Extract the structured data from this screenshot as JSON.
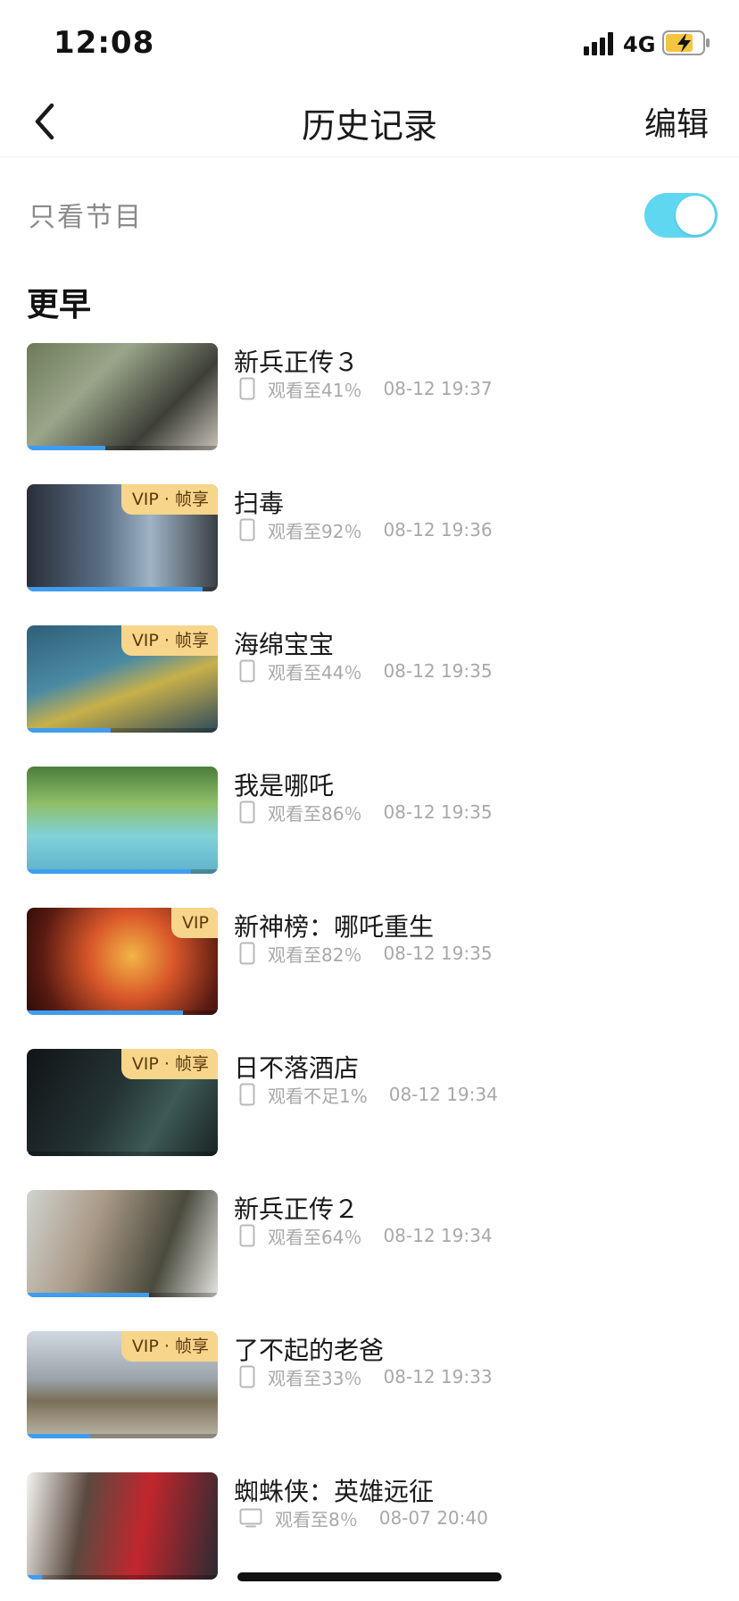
{
  "status_bar": {
    "time": "12:08",
    "network": "4G",
    "icons": [
      "signal-icon",
      "battery-charging-icon"
    ],
    "battery_color": "#f5c542"
  },
  "nav": {
    "back_icon": "chevron-left-icon",
    "title": "历史记录",
    "edit_label": "编辑"
  },
  "filter": {
    "label": "只看节目",
    "toggle_on": true,
    "toggle_color": "#5fd7f0"
  },
  "section": {
    "title": "更早"
  },
  "colors": {
    "badge_bg": "#f7d58a",
    "badge_text": "#5b3a10",
    "progress": "#3f9df0"
  },
  "history": [
    {
      "title": "新兵正传３",
      "badge": "",
      "progress_text": "观看至41％",
      "time": "08-12 19:37",
      "device": "phone-icon",
      "progress": 0.41
    },
    {
      "title": "扫毒",
      "badge": "VIP · 帧享",
      "progress_text": "观看至92％",
      "time": "08-12 19:36",
      "device": "phone-icon",
      "progress": 0.92
    },
    {
      "title": "海绵宝宝",
      "badge": "VIP · 帧享",
      "progress_text": "观看至44％",
      "time": "08-12 19:35",
      "device": "phone-icon",
      "progress": 0.44
    },
    {
      "title": "我是哪吒",
      "badge": "",
      "progress_text": "观看至86％",
      "time": "08-12 19:35",
      "device": "phone-icon",
      "progress": 0.86
    },
    {
      "title": "新神榜：哪吒重生",
      "badge": "VIP",
      "progress_text": "观看至82％",
      "time": "08-12 19:35",
      "device": "phone-icon",
      "progress": 0.82
    },
    {
      "title": "日不落酒店",
      "badge": "VIP · 帧享",
      "progress_text": "观看不足1%",
      "time": "08-12 19:34",
      "device": "phone-icon",
      "progress": 0.01
    },
    {
      "title": "新兵正传２",
      "badge": "",
      "progress_text": "观看至64％",
      "time": "08-12 19:34",
      "device": "phone-icon",
      "progress": 0.64
    },
    {
      "title": "了不起的老爸",
      "badge": "VIP · 帧享",
      "progress_text": "观看至33％",
      "time": "08-12 19:33",
      "device": "phone-icon",
      "progress": 0.33
    },
    {
      "title": "蜘蛛侠：英雄远征",
      "badge": "",
      "progress_text": "观看至8％",
      "time": "08-07 20:40",
      "device": "tv-icon",
      "progress": 0.08
    }
  ]
}
